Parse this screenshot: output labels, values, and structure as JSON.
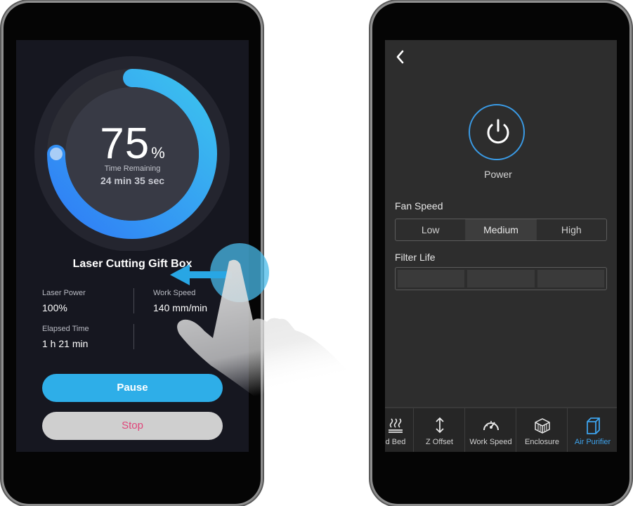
{
  "progress": {
    "percent_value": "75",
    "percent_unit": "%",
    "fraction": 0.75,
    "time_label": "Time Remaining",
    "time_value": "24 min 35 sec"
  },
  "job": {
    "title": "Laser Cutting Gift Box",
    "stats": {
      "laser_power_label": "Laser Power",
      "laser_power_value": "100%",
      "work_speed_label": "Work Speed",
      "work_speed_value": "140 mm/min",
      "elapsed_label": "Elapsed Time",
      "elapsed_value": "1 h 21 min"
    }
  },
  "buttons": {
    "pause": "Pause",
    "stop": "Stop"
  },
  "purifier": {
    "power_label": "Power",
    "fan_speed_label": "Fan Speed",
    "fan_options": [
      "Low",
      "Medium",
      "High"
    ],
    "fan_selected": "Medium",
    "filter_life_label": "Filter Life"
  },
  "tabs": [
    {
      "label": "d Bed",
      "icon": "heated-bed-icon"
    },
    {
      "label": "Z Offset",
      "icon": "z-offset-icon"
    },
    {
      "label": "Work Speed",
      "icon": "speedometer-icon"
    },
    {
      "label": "Enclosure",
      "icon": "enclosure-icon"
    },
    {
      "label": "Air Purifier",
      "icon": "air-purifier-icon",
      "active": true
    }
  ],
  "colors": {
    "accent_blue": "#2eaee8",
    "ring_start": "#2f7cf6",
    "ring_end": "#3cc4ee",
    "stop_text": "#e0457a",
    "active_tab": "#3ea3ec"
  }
}
